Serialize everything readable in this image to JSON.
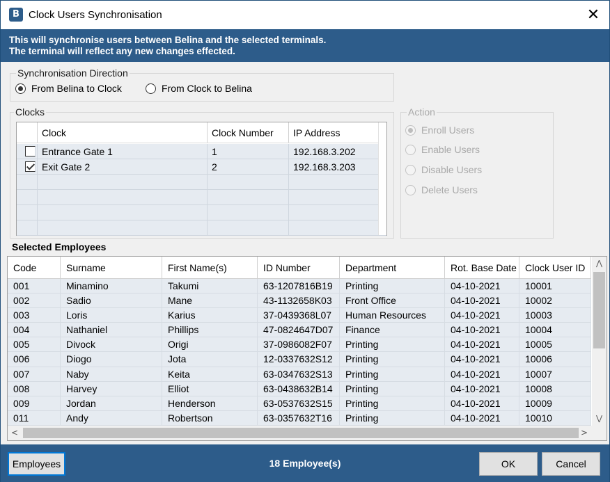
{
  "window": {
    "title": "Clock Users Synchronisation",
    "close_glyph": "✕",
    "icon_letter": "B"
  },
  "banner": {
    "line1": "This will synchronise users between Belina and the selected terminals.",
    "line2": "The terminal will reflect any new changes effected."
  },
  "direction": {
    "label": "Synchronisation Direction",
    "options": [
      {
        "label": "From Belina to Clock",
        "selected": true
      },
      {
        "label": "From Clock to Belina",
        "selected": false
      }
    ]
  },
  "clocks": {
    "label": "Clocks",
    "columns": [
      "Clock",
      "Clock Number",
      "IP Address"
    ],
    "rows": [
      {
        "checked": false,
        "clock": "Entrance Gate 1",
        "number": "1",
        "ip": "192.168.3.202"
      },
      {
        "checked": true,
        "clock": "Exit Gate 2",
        "number": "2",
        "ip": "192.168.3.203"
      }
    ]
  },
  "action": {
    "label": "Action",
    "options": [
      {
        "label": "Enroll Users",
        "selected": true
      },
      {
        "label": "Enable Users",
        "selected": false
      },
      {
        "label": "Disable Users",
        "selected": false
      },
      {
        "label": "Delete Users",
        "selected": false
      }
    ]
  },
  "employees": {
    "title": "Selected Employees",
    "columns": [
      "Code",
      "Surname",
      "First Name(s)",
      "ID Number",
      "Department",
      "Rot. Base Date",
      "Clock User ID"
    ],
    "rows": [
      [
        "001",
        "Minamino",
        "Takumi",
        "63-1207816B19",
        "Printing",
        "04-10-2021",
        "10001"
      ],
      [
        "002",
        "Sadio",
        "Mane",
        "43-1132658K03",
        "Front Office",
        "04-10-2021",
        "10002"
      ],
      [
        "003",
        "Loris",
        "Karius",
        "37-0439368L07",
        "Human Resources",
        "04-10-2021",
        "10003"
      ],
      [
        "004",
        "Nathaniel",
        "Phillips",
        "47-0824647D07",
        "Finance",
        "04-10-2021",
        "10004"
      ],
      [
        "005",
        "Divock",
        "Origi",
        "37-0986082F07",
        "Printing",
        "04-10-2021",
        "10005"
      ],
      [
        "006",
        "Diogo",
        "Jota",
        "12-0337632S12",
        "Printing",
        "04-10-2021",
        "10006"
      ],
      [
        "007",
        "Naby",
        "Keita",
        "63-0347632S13",
        "Printing",
        "04-10-2021",
        "10007"
      ],
      [
        "008",
        "Harvey",
        "Elliot",
        "63-0438632B14",
        "Printing",
        "04-10-2021",
        "10008"
      ],
      [
        "009",
        "Jordan",
        "Henderson",
        "63-0537632S15",
        "Printing",
        "04-10-2021",
        "10009"
      ],
      [
        "011",
        "Andy",
        "Robertson",
        "63-0357632T16",
        "Printing",
        "04-10-2021",
        "10010"
      ]
    ]
  },
  "footer": {
    "employees_button": "Employees",
    "count": "18 Employee(s)",
    "ok_button": "OK",
    "cancel_button": "Cancel"
  },
  "colors": {
    "accent": "#2d5c8a",
    "row_bg": "#e6ebf1"
  }
}
